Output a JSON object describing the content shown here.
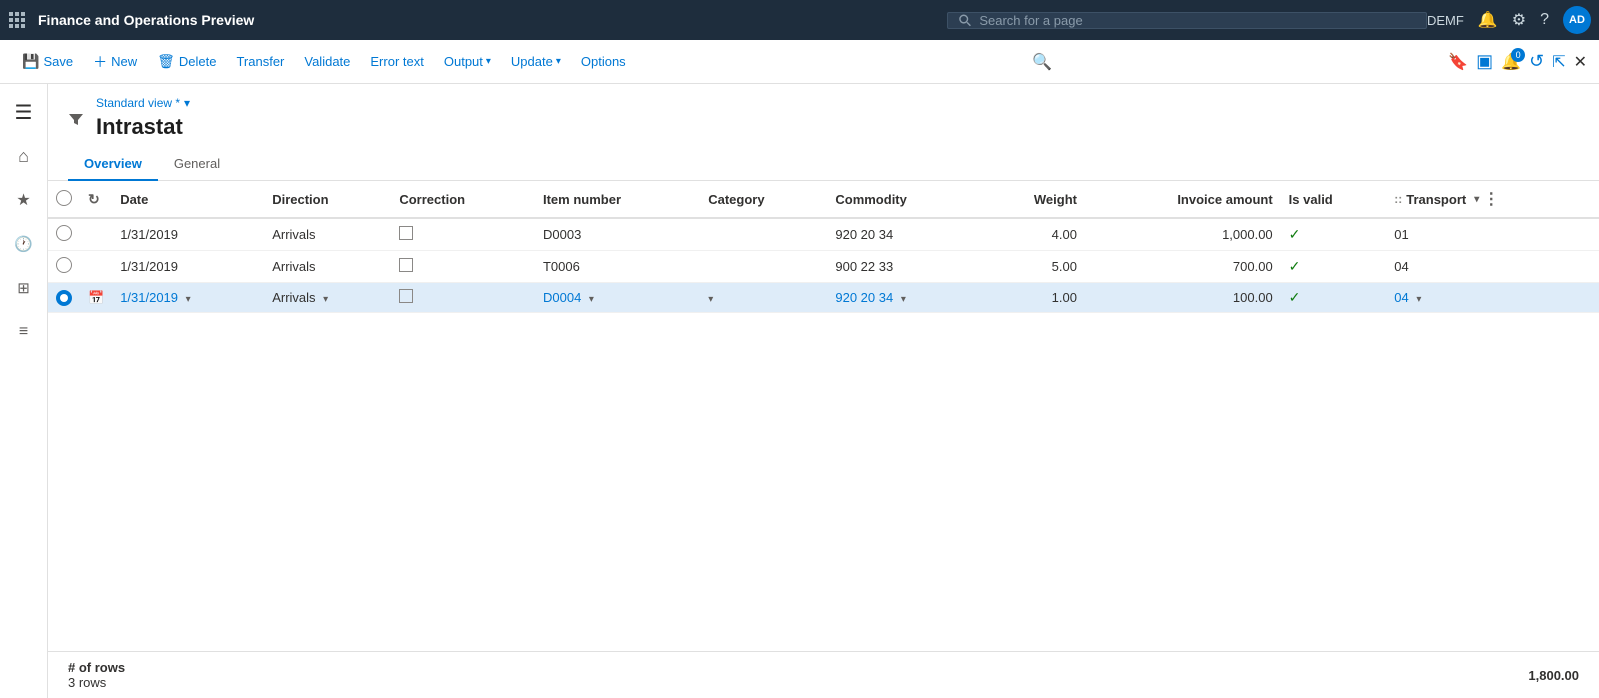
{
  "app": {
    "title": "Finance and Operations Preview",
    "env": "DEMF"
  },
  "topnav": {
    "search_placeholder": "Search for a page",
    "avatar_initials": "AD",
    "notification_count": "0"
  },
  "commandbar": {
    "save": "Save",
    "new": "New",
    "delete": "Delete",
    "transfer": "Transfer",
    "validate": "Validate",
    "error_text": "Error text",
    "output": "Output",
    "update": "Update",
    "options": "Options"
  },
  "sidebar": {
    "icons": [
      {
        "name": "hamburger-icon",
        "symbol": "☰"
      },
      {
        "name": "home-icon",
        "symbol": "⌂"
      },
      {
        "name": "favorites-icon",
        "symbol": "★"
      },
      {
        "name": "recent-icon",
        "symbol": "🕐"
      },
      {
        "name": "dashboard-icon",
        "symbol": "⊞"
      },
      {
        "name": "list-icon",
        "symbol": "≡"
      }
    ]
  },
  "page": {
    "view_label": "Standard view *",
    "title": "Intrastat",
    "tabs": [
      {
        "id": "overview",
        "label": "Overview",
        "active": true
      },
      {
        "id": "general",
        "label": "General",
        "active": false
      }
    ]
  },
  "table": {
    "columns": [
      {
        "id": "select",
        "label": ""
      },
      {
        "id": "refresh",
        "label": ""
      },
      {
        "id": "date",
        "label": "Date"
      },
      {
        "id": "direction",
        "label": "Direction"
      },
      {
        "id": "correction",
        "label": "Correction"
      },
      {
        "id": "item_number",
        "label": "Item number"
      },
      {
        "id": "category",
        "label": "Category"
      },
      {
        "id": "commodity",
        "label": "Commodity"
      },
      {
        "id": "weight",
        "label": "Weight",
        "align": "right"
      },
      {
        "id": "invoice_amount",
        "label": "Invoice amount",
        "align": "right"
      },
      {
        "id": "is_valid",
        "label": "Is valid"
      },
      {
        "id": "transport",
        "label": "Transport"
      }
    ],
    "rows": [
      {
        "id": 1,
        "selected": false,
        "date": "1/31/2019",
        "direction": "Arrivals",
        "correction": false,
        "item_number": "D0003",
        "category": "",
        "commodity": "920 20 34",
        "weight": "4.00",
        "invoice_amount": "1,000.00",
        "is_valid": true,
        "transport": "01",
        "editing": false
      },
      {
        "id": 2,
        "selected": false,
        "date": "1/31/2019",
        "direction": "Arrivals",
        "correction": false,
        "item_number": "T0006",
        "category": "",
        "commodity": "900 22 33",
        "weight": "5.00",
        "invoice_amount": "700.00",
        "is_valid": true,
        "transport": "04",
        "editing": false
      },
      {
        "id": 3,
        "selected": true,
        "date": "1/31/2019",
        "direction": "Arrivals",
        "correction": false,
        "item_number": "D0004",
        "category": "",
        "commodity": "920 20 34",
        "weight": "1.00",
        "invoice_amount": "100.00",
        "is_valid": true,
        "transport": "04",
        "editing": true
      }
    ]
  },
  "footer": {
    "rows_label": "# of rows",
    "rows_count": "3 rows",
    "total": "1,800.00"
  },
  "toolbar_right": {
    "icons": [
      {
        "name": "bookmark-icon",
        "symbol": "🔖"
      },
      {
        "name": "panel-icon",
        "symbol": "▣"
      },
      {
        "name": "notification-icon",
        "symbol": "🔔"
      },
      {
        "name": "refresh-icon",
        "symbol": "↺"
      },
      {
        "name": "popout-icon",
        "symbol": "⇱"
      },
      {
        "name": "close-icon",
        "symbol": "✕"
      }
    ]
  }
}
